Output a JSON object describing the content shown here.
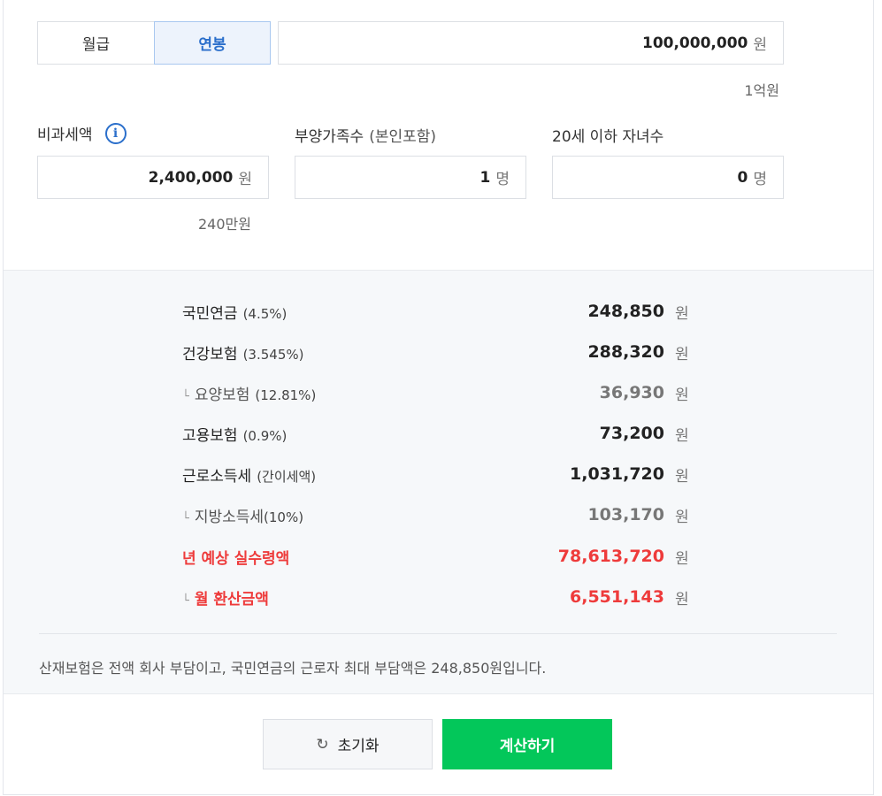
{
  "mode_tabs": [
    {
      "label": "월급",
      "active": false
    },
    {
      "label": "연봉",
      "active": true
    }
  ],
  "salary": {
    "value": "100,000,000",
    "unit": "원",
    "hint": "1억원"
  },
  "nontax": {
    "label": "비과세액",
    "info_icon": "info-icon",
    "value": "2,400,000",
    "unit": "원",
    "hint": "240만원"
  },
  "dependents": {
    "label": "부양가족수",
    "sub": "(본인포함)",
    "value": "1",
    "unit": "명"
  },
  "children": {
    "label": "20세 이하 자녀수",
    "value": "0",
    "unit": "명"
  },
  "results": [
    {
      "name": "국민연금",
      "pct": "(4.5%)",
      "amount": "248,850",
      "unit": "원",
      "style": "normal",
      "branch": ""
    },
    {
      "name": "건강보험",
      "pct": "(3.545%)",
      "amount": "288,320",
      "unit": "원",
      "style": "normal",
      "branch": ""
    },
    {
      "name": "요양보험",
      "pct": "(12.81%)",
      "amount": "36,930",
      "unit": "원",
      "style": "sub",
      "branch": "└"
    },
    {
      "name": "고용보험",
      "pct": "(0.9%)",
      "amount": "73,200",
      "unit": "원",
      "style": "normal",
      "branch": ""
    },
    {
      "name": "근로소득세",
      "pct": "(간이세액)",
      "amount": "1,031,720",
      "unit": "원",
      "style": "normal",
      "branch": ""
    },
    {
      "name": "지방소득세",
      "pct": "(10%)",
      "amount": "103,170",
      "unit": "원",
      "style": "sub",
      "branch": "└"
    },
    {
      "name": "년 예상 실수령액",
      "pct": "",
      "amount": "78,613,720",
      "unit": "원",
      "style": "red",
      "branch": ""
    },
    {
      "name": "월 환산금액",
      "pct": "",
      "amount": "6,551,143",
      "unit": "원",
      "style": "red",
      "branch": "└"
    }
  ],
  "note": "산재보험은 전액 회사 부담이고, 국민연금의 근로자 최대 부담액은 248,850원입니다.",
  "buttons": {
    "reset_icon": "refresh-icon",
    "reset_label": "초기화",
    "calc_label": "계산하기"
  },
  "colors": {
    "accent_blue": "#2b6fcb",
    "red": "#ee3b3b",
    "green": "#03c75a"
  }
}
